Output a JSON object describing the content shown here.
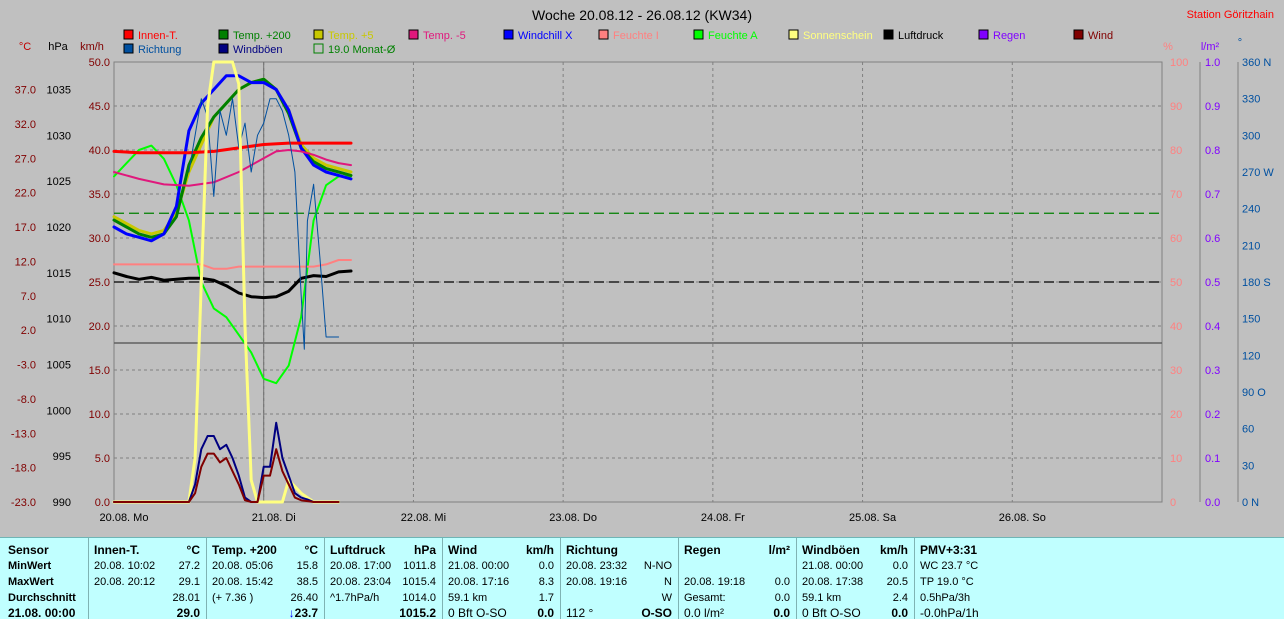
{
  "chart_data": {
    "type": "line",
    "title": "Woche 20.08.12 - 26.08.12 (KW34)",
    "station": "Station Göritzhain",
    "legend": [
      {
        "name": "Innen-T.",
        "color": "#ff0000"
      },
      {
        "name": "Temp. +200",
        "color": "#008000"
      },
      {
        "name": "Temp. +5",
        "color": "#c8c800"
      },
      {
        "name": "Temp. -5",
        "color": "#e0187c"
      },
      {
        "name": "Windchill X",
        "color": "#0000ff"
      },
      {
        "name": "Feuchte I",
        "color": "#ff8080"
      },
      {
        "name": "Feuchte A",
        "color": "#00ff00"
      },
      {
        "name": "Sonnenschein",
        "color": "#ffff80"
      },
      {
        "name": "Luftdruck",
        "color": "#000000"
      },
      {
        "name": "Regen",
        "color": "#8000ff"
      },
      {
        "name": "Wind",
        "color": "#800000"
      },
      {
        "name": "Richtung",
        "color": "#0050a0"
      },
      {
        "name": "Windböen",
        "color": "#000080"
      },
      {
        "name": "19.0 Monat-Ø",
        "color": "#008000"
      }
    ],
    "axes": {
      "celsius": {
        "label": "°C",
        "ticks": [
          "37.0",
          "32.0",
          "27.0",
          "22.0",
          "17.0",
          "12.0",
          "7.0",
          "2.0",
          "-3.0",
          "-8.0",
          "-13.0",
          "-18.0",
          "-23.0"
        ],
        "range": [
          -23,
          41
        ],
        "color": "#800000"
      },
      "hpa": {
        "label": "hPa",
        "ticks": [
          "1035",
          "1030",
          "1025",
          "1020",
          "1015",
          "1010",
          "1005",
          "1000",
          "995",
          "990"
        ],
        "range": [
          990,
          1038
        ],
        "color": "#000000"
      },
      "kmh": {
        "label": "km/h",
        "ticks": [
          "50.0",
          "45.0",
          "40.0",
          "35.0",
          "30.0",
          "25.0",
          "20.0",
          "15.0",
          "10.0",
          "5.0",
          "0.0"
        ],
        "range": [
          0,
          50
        ],
        "color": "#800000"
      },
      "percent": {
        "label": "%",
        "ticks": [
          "100",
          "90",
          "80",
          "70",
          "60",
          "50",
          "40",
          "30",
          "20",
          "10",
          "0"
        ],
        "range": [
          0,
          100
        ],
        "color": "#ff8080"
      },
      "rain": {
        "label": "l/m²",
        "ticks": [
          "1.0",
          "0.9",
          "0.8",
          "0.7",
          "0.6",
          "0.5",
          "0.4",
          "0.3",
          "0.2",
          "0.1",
          "0.0"
        ],
        "range": [
          0,
          1
        ],
        "color": "#8000ff"
      },
      "direction": {
        "label": "°",
        "ticks": [
          "360 N",
          "330",
          "300",
          "270 W",
          "240",
          "210",
          "180 S",
          "150",
          "120",
          "90 O",
          "60",
          "30",
          "0 N"
        ],
        "range": [
          0,
          360
        ],
        "color": "#0050a0"
      }
    },
    "x_labels": [
      "20.08. Mo",
      "21.08. Di",
      "22.08. Mi",
      "23.08. Do",
      "24.08. Fr",
      "25.08. Sa",
      "26.08. So"
    ],
    "x_range_hours": [
      0,
      168
    ],
    "reference_lines": [
      {
        "name": "19.0 Monat-Ø",
        "axis": "celsius",
        "value": 19.0,
        "color": "#008000"
      },
      {
        "name": "Luftdruck-Mittel",
        "axis": "hpa",
        "value": 1014.0,
        "color": "#000000"
      }
    ],
    "series": [
      {
        "name": "Feuchte A",
        "axis": "percent",
        "color": "#00ff00",
        "width": 2,
        "x": [
          0,
          2,
          4,
          6,
          8,
          10,
          12,
          14,
          16,
          18,
          20,
          22,
          24,
          26,
          28,
          30,
          32,
          34,
          36,
          38
        ],
        "y": [
          74,
          77,
          80,
          81,
          78,
          72,
          64,
          50,
          44,
          42,
          38,
          34,
          28,
          27,
          31,
          42,
          64,
          72,
          74,
          74
        ]
      },
      {
        "name": "Temp. +5",
        "axis": "celsius",
        "color": "#c8c800",
        "width": 3,
        "x": [
          0,
          2,
          4,
          6,
          8,
          10,
          12,
          14,
          16,
          18,
          20,
          22,
          24,
          26,
          28,
          30,
          32,
          34,
          36,
          38
        ],
        "y": [
          18.5,
          17.5,
          16.5,
          16,
          16.5,
          19,
          25,
          29,
          33,
          35,
          37,
          38,
          38.5,
          37,
          34,
          29,
          27,
          26,
          25.5,
          25
        ]
      },
      {
        "name": "Temp. +200",
        "axis": "celsius",
        "color": "#008000",
        "width": 3,
        "x": [
          0,
          2,
          4,
          6,
          8,
          10,
          12,
          14,
          16,
          18,
          20,
          22,
          24,
          26,
          28,
          30,
          32,
          34,
          36,
          38
        ],
        "y": [
          18,
          17,
          16,
          15.5,
          16,
          18.5,
          26,
          30,
          33,
          35,
          37,
          38,
          38.5,
          37,
          33.5,
          28.5,
          26.5,
          25.5,
          25,
          24.5
        ]
      },
      {
        "name": "Windchill X",
        "axis": "celsius",
        "color": "#0000ff",
        "width": 3,
        "x": [
          0,
          2,
          4,
          6,
          8,
          10,
          12,
          14,
          16,
          18,
          20,
          22,
          24,
          26,
          28,
          30,
          32,
          34,
          36,
          38
        ],
        "y": [
          17,
          16,
          15.5,
          15,
          16,
          20,
          31,
          35,
          37,
          39,
          39,
          38,
          38,
          37,
          34,
          28.5,
          26,
          25,
          24.5,
          24
        ]
      },
      {
        "name": "Innen-T.",
        "axis": "celsius",
        "color": "#ff0000",
        "width": 3,
        "x": [
          0,
          4,
          8,
          12,
          16,
          20,
          24,
          28,
          32,
          36,
          38
        ],
        "y": [
          28,
          27.8,
          27.8,
          27.8,
          28,
          28.5,
          29,
          29.2,
          29.2,
          29.2,
          29.2
        ]
      },
      {
        "name": "Temp. -5",
        "axis": "celsius",
        "color": "#e0187c",
        "width": 2,
        "x": [
          0,
          4,
          8,
          12,
          16,
          20,
          24,
          26,
          28,
          30,
          32,
          34,
          36,
          38
        ],
        "y": [
          25,
          24,
          23.2,
          23,
          23.5,
          25,
          27,
          28,
          28.2,
          28,
          27.5,
          26.8,
          26.3,
          26
        ]
      },
      {
        "name": "Feuchte I",
        "axis": "percent",
        "color": "#ff8080",
        "width": 2,
        "x": [
          0,
          4,
          8,
          12,
          14,
          16,
          18,
          20,
          22,
          24,
          26,
          28,
          30,
          32,
          34,
          36,
          38
        ],
        "y": [
          54,
          54,
          54,
          54,
          54,
          53,
          53,
          53.5,
          53.5,
          53.5,
          53.5,
          53.5,
          53.5,
          53.5,
          54,
          55,
          55
        ]
      },
      {
        "name": "Luftdruck",
        "axis": "hpa",
        "color": "#000000",
        "width": 3,
        "x": [
          0,
          2,
          4,
          6,
          8,
          10,
          12,
          14,
          16,
          18,
          20,
          22,
          24,
          26,
          28,
          30,
          32,
          34,
          36,
          38
        ],
        "y": [
          1015,
          1014.6,
          1014.3,
          1014.5,
          1014.2,
          1014.3,
          1014.4,
          1014.4,
          1014.2,
          1013.6,
          1012.8,
          1012.4,
          1012.3,
          1012.4,
          1013,
          1014.4,
          1014.7,
          1014.6,
          1015.1,
          1015.2
        ]
      },
      {
        "name": "Richtung",
        "axis": "direction",
        "color": "#0050a0",
        "width": 1,
        "x": [
          12,
          13,
          14,
          15,
          16,
          17,
          18,
          19,
          20,
          21,
          22,
          23,
          24,
          25,
          26,
          27,
          28,
          29,
          30,
          30.5,
          31,
          32,
          33,
          34,
          35,
          36
        ],
        "y": [
          270,
          300,
          330,
          315,
          250,
          320,
          300,
          330,
          290,
          310,
          270,
          300,
          310,
          330,
          330,
          320,
          300,
          270,
          170,
          125,
          230,
          260,
          200,
          135,
          135,
          135
        ]
      },
      {
        "name": "Sonnenschein",
        "axis": "percent",
        "color": "#ffff80",
        "width": 3,
        "x": [
          0,
          2,
          4,
          6,
          8,
          10,
          12,
          13,
          14,
          15,
          16,
          17,
          18,
          19,
          20,
          21,
          22,
          23,
          24,
          25,
          26,
          27,
          28,
          30,
          32,
          34,
          36
        ],
        "y": [
          0,
          0,
          0,
          0,
          0,
          0,
          0,
          10,
          50,
          90,
          100,
          100,
          100,
          100,
          95,
          40,
          5,
          0,
          0,
          0,
          0,
          0,
          5,
          2,
          0,
          0,
          0
        ]
      },
      {
        "name": "Windböen",
        "axis": "kmh",
        "color": "#000080",
        "width": 2,
        "x": [
          0,
          4,
          8,
          10,
          12,
          13,
          14,
          15,
          16,
          17,
          18,
          19,
          20,
          21,
          22,
          23,
          24,
          25,
          26,
          27,
          28,
          29,
          30,
          31,
          32,
          34,
          36
        ],
        "y": [
          0,
          0,
          0,
          0,
          0,
          2,
          6,
          7.5,
          7.5,
          6,
          6.5,
          5,
          3,
          0.5,
          0,
          0,
          4,
          4,
          9,
          5,
          3,
          1,
          0.5,
          0.3,
          0,
          0,
          0
        ]
      },
      {
        "name": "Wind",
        "axis": "kmh",
        "color": "#800000",
        "width": 2,
        "x": [
          0,
          4,
          8,
          10,
          12,
          13,
          14,
          15,
          16,
          17,
          18,
          19,
          20,
          21,
          22,
          23,
          24,
          25,
          26,
          27,
          28,
          29,
          30,
          31,
          32,
          34,
          36
        ],
        "y": [
          0,
          0,
          0,
          0,
          0,
          1,
          4,
          5.5,
          5.5,
          4.5,
          5,
          3.5,
          2,
          0.2,
          0,
          0,
          3,
          3,
          6,
          3.5,
          2,
          0.5,
          0.2,
          0.1,
          0,
          0,
          0
        ]
      }
    ]
  },
  "panel": {
    "row_labels": [
      "Sensor",
      "MinWert",
      "MaxWert",
      "Durchschnitt",
      "21.08.  00:00"
    ],
    "columns": [
      {
        "title": "Innen-T.",
        "unit": "°C",
        "rows": [
          [
            "20.08.  10:02",
            "27.2"
          ],
          [
            "20.08.  20:12",
            "29.1"
          ],
          [
            "",
            "28.01"
          ],
          [
            "",
            "29.0"
          ]
        ]
      },
      {
        "title": "Temp. +200",
        "unit": "°C",
        "rows": [
          [
            "20.08.  05:06",
            "15.8"
          ],
          [
            "20.08.  15:42",
            "38.5"
          ],
          [
            "(+ 7.36 )",
            "26.40"
          ],
          [
            "",
            "↓23.7"
          ]
        ]
      },
      {
        "title": "Luftdruck",
        "unit": "hPa",
        "rows": [
          [
            "20.08.  17:00",
            "1011.8"
          ],
          [
            "20.08.  23:04",
            "1015.4"
          ],
          [
            "^1.7hPa/h",
            "1014.0"
          ],
          [
            "",
            "1015.2"
          ]
        ]
      },
      {
        "title": "Wind",
        "unit": "km/h",
        "rows": [
          [
            "21.08.  00:00",
            "0.0"
          ],
          [
            "20.08.  17:16",
            "8.3"
          ],
          [
            "59.1 km",
            "1.7"
          ],
          [
            "0 Bft O-SO",
            "0.0"
          ]
        ]
      },
      {
        "title": "Richtung",
        "unit": "",
        "rows": [
          [
            "20.08.  23:32",
            "N-NO"
          ],
          [
            "20.08.  19:16",
            "N"
          ],
          [
            "",
            "W"
          ],
          [
            "112 °",
            "O-SO"
          ]
        ]
      },
      {
        "title": "Regen",
        "unit": "l/m²",
        "rows": [
          [
            "",
            ""
          ],
          [
            "20.08.  19:18",
            "0.0"
          ],
          [
            "Gesamt:",
            "0.0"
          ],
          [
            "0.0 l/m²",
            "0.0"
          ]
        ]
      },
      {
        "title": "Windböen",
        "unit": "km/h",
        "rows": [
          [
            "21.08.  00:00",
            "0.0"
          ],
          [
            "20.08.  17:38",
            "20.5"
          ],
          [
            "59.1 km",
            "2.4"
          ],
          [
            "0 Bft O-SO",
            "0.0"
          ]
        ]
      },
      {
        "title": "PMV+3:31",
        "unit": "",
        "rows": [
          [
            "WC 23.7 °C",
            ""
          ],
          [
            "TP 19.0 °C",
            ""
          ],
          [
            "0.5hPa/3h",
            ""
          ],
          [
            "-0.0hPa/1h",
            ""
          ]
        ]
      }
    ]
  }
}
